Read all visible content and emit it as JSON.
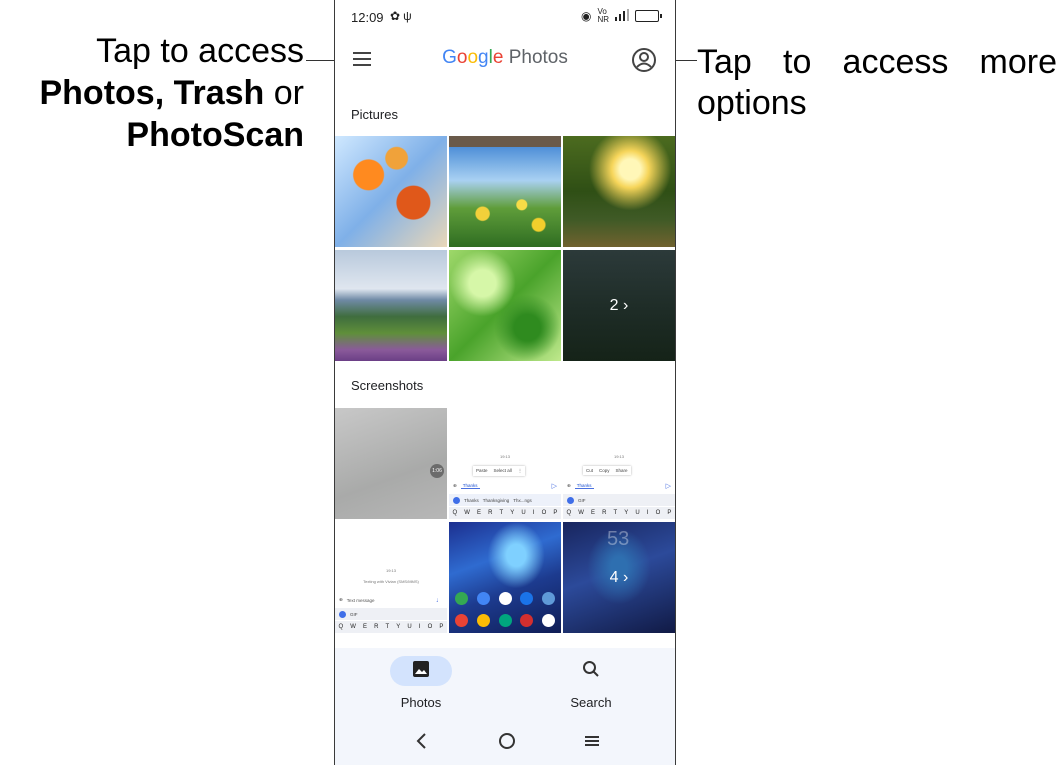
{
  "annotations": {
    "left_line1": "Tap to access",
    "left_bold1": "Photos, Trash",
    "left_or": " or",
    "left_bold2": "PhotoScan",
    "right_text": "Tap to access more options"
  },
  "status_bar": {
    "time": "12:09",
    "left_icons": [
      "settings-icon",
      "usb-icon"
    ],
    "right_icons": [
      "nfc-icon",
      "vonr-icon",
      "signal-icon",
      "battery-icon"
    ],
    "vo": "Vo",
    "nr": "NR",
    "battery_level": 1.0,
    "battery_color": "#1ec21e"
  },
  "app_bar": {
    "logo_letters": [
      "G",
      "o",
      "o",
      "g",
      "l",
      "e"
    ],
    "logo_suffix": " Photos",
    "menu_icon": "hamburger-menu-icon",
    "account_icon": "account-circle-icon"
  },
  "sections": {
    "pictures": {
      "title": "Pictures",
      "more_count": "2",
      "more_chevron": "›"
    },
    "screenshots": {
      "title": "Screenshots",
      "more_count": "4",
      "more_chevron": "›",
      "shot1": {
        "time": "19:13",
        "paste": "Paste",
        "select_all": "Select all",
        "more": "⋮",
        "input": "Thanks",
        "sugg1": "Thanks",
        "sugg2": "Thanksgiving",
        "sugg3": "Thx...ngs"
      },
      "shot2": {
        "time": "19:13",
        "cut": "Cut",
        "copy": "Copy",
        "share": "Share",
        "input": "Thanks",
        "gif": "GIF"
      },
      "shot3": {
        "time": "19:13",
        "title": "Texting with Vivian (SMS/MMS)",
        "input": "Text message",
        "gif": "GIF"
      },
      "shot4": {
        "big_num": "53"
      },
      "keyboard_row": [
        "Q",
        "W",
        "E",
        "R",
        "T",
        "Y",
        "U",
        "I",
        "O",
        "P"
      ],
      "gray_badge": "1:06"
    }
  },
  "bottom_nav": {
    "items": [
      {
        "label": "Photos",
        "icon": "photo-icon",
        "active": true
      },
      {
        "label": "Search",
        "icon": "search-icon",
        "active": false
      }
    ],
    "accent": "#d3e3fd"
  },
  "system_nav": {
    "back_icon": "back-icon",
    "home_icon": "home-icon",
    "recents_icon": "recents-icon"
  }
}
